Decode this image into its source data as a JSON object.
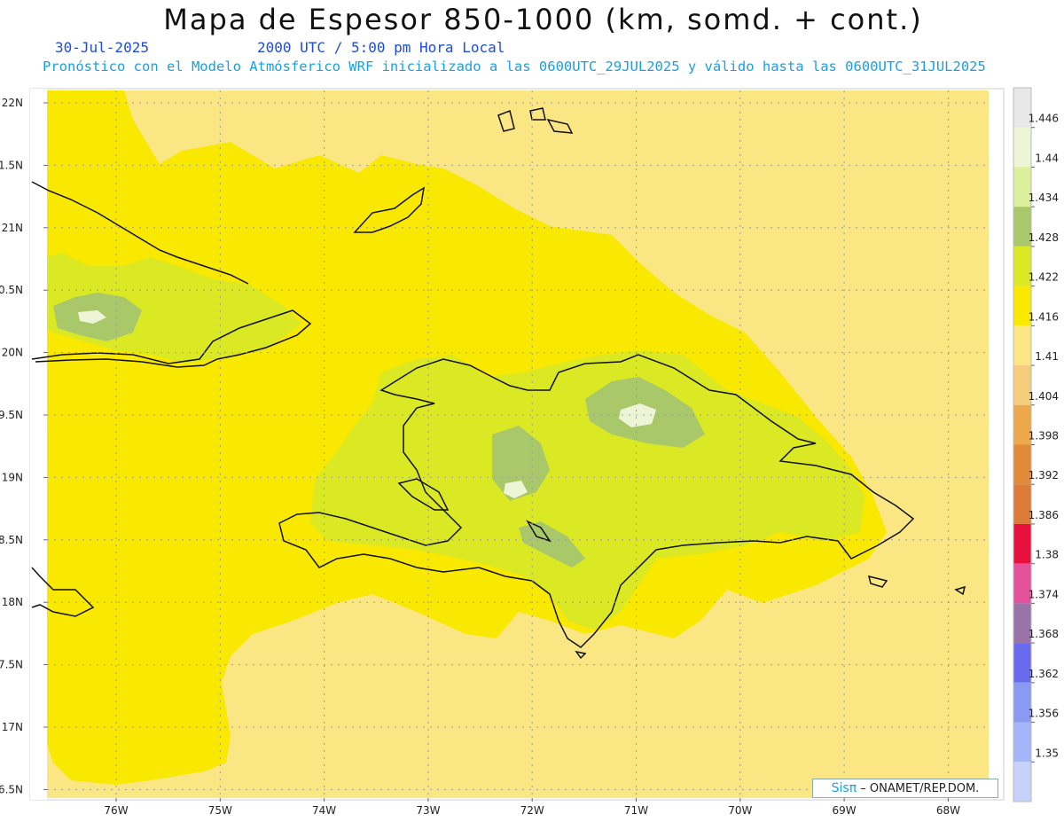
{
  "title": "Mapa de Espesor 850-1000 (km, somd. + cont.)",
  "date": "30-Jul-2025",
  "time": "2000 UTC / 5:00 pm Hora Local",
  "subtitle": "Pronóstico con el Modelo Atmósferico WRF inicializado a las 0600UTC_29JUL2025 y válido hasta las  0600UTC_31JUL2025",
  "credit": {
    "logo": "Sisπ",
    "text": "– ONAMET/REP.DOM."
  },
  "axes": {
    "x_ticks": [
      "76W",
      "75W",
      "74W",
      "73W",
      "72W",
      "71W",
      "70W",
      "69W",
      "68W"
    ],
    "y_ticks": [
      "22N",
      "1.5N",
      "21N",
      "0.5N",
      "20N",
      "9.5N",
      "19N",
      "8.5N",
      "18N",
      "7.5N",
      "17N",
      "6.5N"
    ]
  },
  "colorbar": {
    "labels": [
      "1.446",
      "1.44",
      "1.434",
      "1.428",
      "1.422",
      "1.416",
      "1.41",
      "1.404",
      "1.398",
      "1.392",
      "1.386",
      "1.38",
      "1.374",
      "1.368",
      "1.362",
      "1.356",
      "1.35"
    ],
    "colors": [
      "#e8e8e8",
      "#eef5d6",
      "#dcef9c",
      "#a9c86a",
      "#dbe824",
      "#f9e800",
      "#fbe684",
      "#f3cc7c",
      "#eea84c",
      "#e08a3a",
      "#dc7a38",
      "#e8103c",
      "#e4529c",
      "#9a74a8",
      "#6a6aee",
      "#8a9af2",
      "#a4b6f8",
      "#c6d2fa"
    ]
  },
  "colors": {
    "sea": "#fbe684",
    "low_land": "#f9e800",
    "mid": "#dbe824",
    "high": "#a9c86a",
    "peak": "#eef5d6",
    "coast": "#111111",
    "header_blue": "#1e4dd8",
    "header_cyan": "#1a9fe0"
  }
}
